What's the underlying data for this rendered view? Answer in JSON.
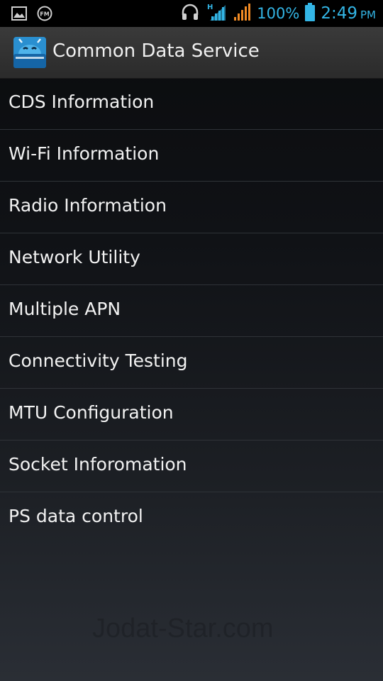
{
  "status_bar": {
    "battery": "100%",
    "time": "2:49",
    "ampm": "PM",
    "network_type": "H",
    "accent_color": "#33b5e5",
    "signal_color_2": "#f08a24",
    "icons": [
      "image-icon",
      "fm-radio-icon",
      "headset-icon",
      "signal-h-icon",
      "signal-icon",
      "battery-icon"
    ]
  },
  "action_bar": {
    "title": "Common Data Service",
    "icon": "android-app-icon"
  },
  "menu": {
    "items": [
      {
        "label": "CDS Information"
      },
      {
        "label": "Wi-Fi Information"
      },
      {
        "label": "Radio Information"
      },
      {
        "label": "Network Utility"
      },
      {
        "label": "Multiple APN"
      },
      {
        "label": "Connectivity Testing"
      },
      {
        "label": "MTU Configuration"
      },
      {
        "label": "Socket Inforomation"
      },
      {
        "label": "PS data control"
      }
    ]
  },
  "watermark": {
    "text": "Jodat-Star.com"
  }
}
